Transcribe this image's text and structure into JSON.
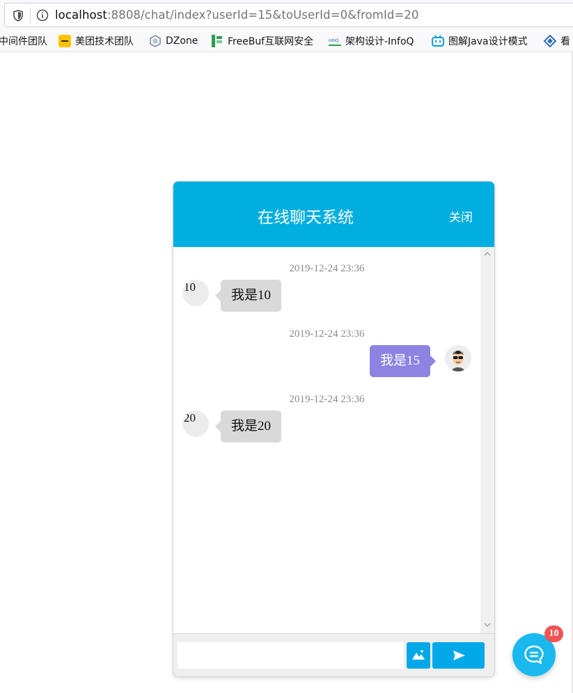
{
  "browser": {
    "url_host": "localhost",
    "url_rest": ":8808/chat/index?userId=15&toUserId=0&fromId=20",
    "bookmarks": [
      {
        "label": "中间件团队",
        "icon": "none"
      },
      {
        "label": "美团技术团队",
        "icon": "meituan-icon"
      },
      {
        "label": "DZone",
        "icon": "dzone-icon"
      },
      {
        "label": "FreeBuf互联网安全",
        "icon": "freebuf-icon"
      },
      {
        "label": "架构设计-InfoQ",
        "icon": "infoq-icon"
      },
      {
        "label": "图解Java设计模式",
        "icon": "bilibili-icon"
      },
      {
        "label": "看",
        "icon": "diamond-icon"
      }
    ]
  },
  "chat": {
    "title": "在线聊天系统",
    "close_label": "关闭",
    "messages": [
      {
        "time": "2019-12-24 23:36",
        "side": "left",
        "avatar_text": "10",
        "text": "我是10"
      },
      {
        "time": "2019-12-24 23:36",
        "side": "right",
        "avatar_icon": "user-sunglasses-avatar-icon",
        "text": "我是15"
      },
      {
        "time": "2019-12-24 23:36",
        "side": "left",
        "avatar_text": "20",
        "text": "我是20"
      }
    ],
    "input": {
      "value": "",
      "placeholder": ""
    },
    "image_button_icon": "image-icon",
    "send_button_icon": "send-icon"
  },
  "fab": {
    "icon": "chat-bubble-icon",
    "badge_count": "10"
  },
  "colors": {
    "header": "#00aee0",
    "own_bubble": "#8d83e3",
    "other_bubble": "#d9d9d9",
    "buttons": "#00a8e8",
    "badge": "#f05454"
  }
}
